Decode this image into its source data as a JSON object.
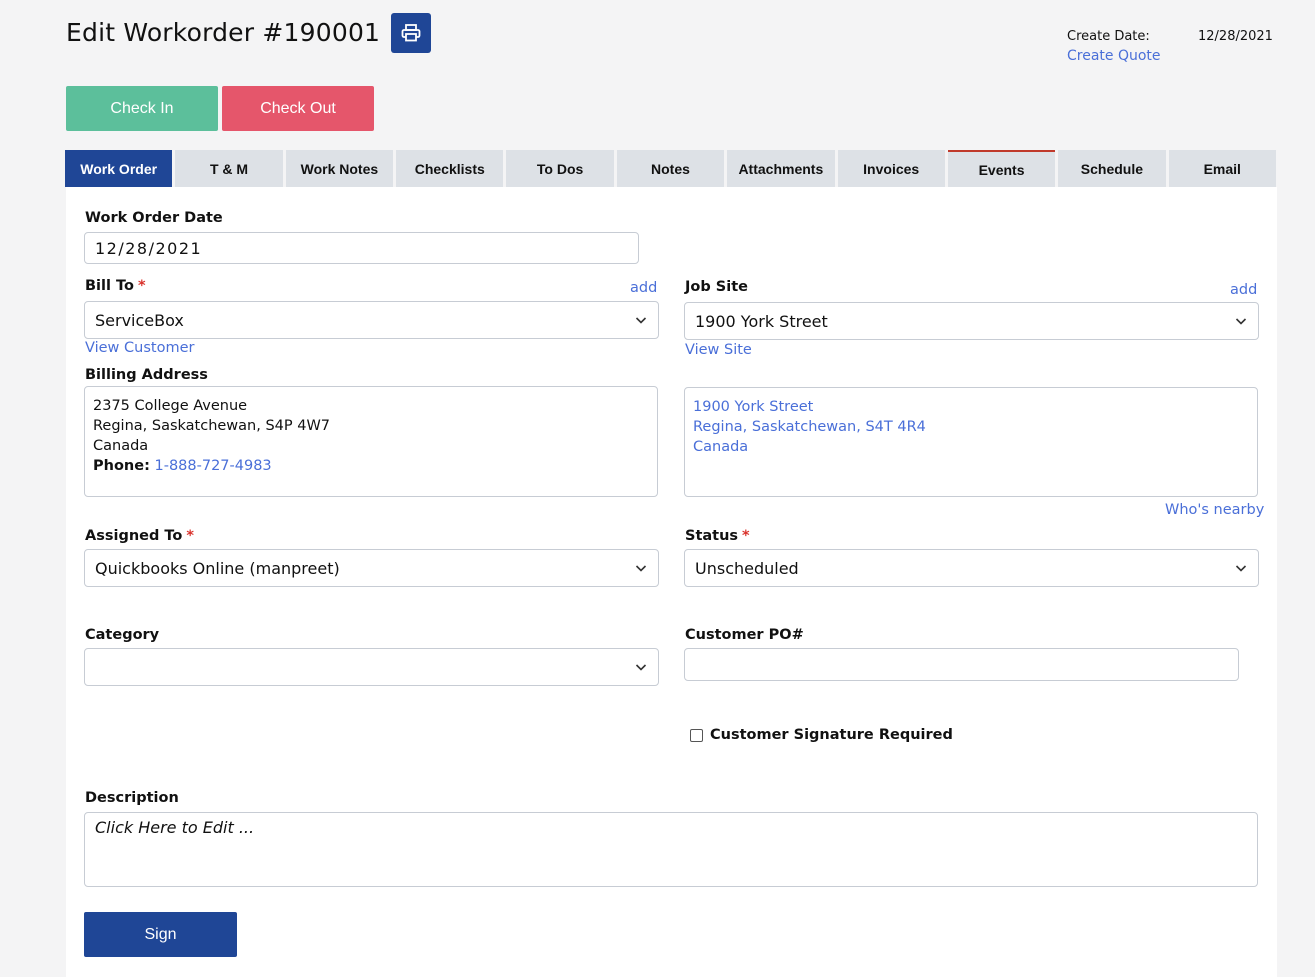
{
  "header": {
    "title": "Edit Workorder #190001",
    "print_icon": "printer-icon",
    "create_date_label": "Create Date:",
    "create_date_value": "12/28/2021",
    "create_quote_link": "Create Quote"
  },
  "actions": {
    "check_in": "Check In",
    "check_out": "Check Out"
  },
  "tabs": [
    {
      "label": "Work Order",
      "active": true
    },
    {
      "label": "T & M"
    },
    {
      "label": "Work Notes"
    },
    {
      "label": "Checklists"
    },
    {
      "label": "To Dos"
    },
    {
      "label": "Notes"
    },
    {
      "label": "Attachments"
    },
    {
      "label": "Invoices"
    },
    {
      "label": "Events"
    },
    {
      "label": "Schedule"
    },
    {
      "label": "Email"
    }
  ],
  "form": {
    "work_order_date_label": "Work Order Date",
    "work_order_date_value": "12/28/2021",
    "bill_to_label": "Bill To",
    "required_mark": "*",
    "add_link": "add",
    "bill_to_value": "ServiceBox",
    "view_customer_link": "View Customer",
    "job_site_label": "Job Site",
    "job_site_value": "1900 York Street",
    "view_site_link": "View Site",
    "billing_address_label": "Billing Address",
    "billing_address": {
      "line1": "2375 College Avenue",
      "line2": "Regina, Saskatchewan, S4P 4W7",
      "line3": "Canada",
      "phone_label": "Phone:",
      "phone_value": "1-888-727-4983"
    },
    "site_address": {
      "line1": "1900 York Street",
      "line2": "Regina, Saskatchewan, S4T 4R4",
      "line3": "Canada"
    },
    "whos_nearby_link": "Who's nearby",
    "assigned_to_label": "Assigned To",
    "assigned_to_value": "Quickbooks Online (manpreet)",
    "status_label": "Status",
    "status_value": "Unscheduled",
    "category_label": "Category",
    "category_value": "",
    "customer_po_label": "Customer PO#",
    "customer_po_value": "",
    "signature_required_label": "Customer Signature Required",
    "signature_required_checked": false,
    "description_label": "Description",
    "description_placeholder": "Click Here to Edit ...",
    "sign_button": "Sign"
  },
  "colors": {
    "primary": "#1f4696",
    "check_in": "#5cbf9b",
    "check_out": "#e5566b",
    "link": "#4a6fd8",
    "required": "#d9322c"
  }
}
